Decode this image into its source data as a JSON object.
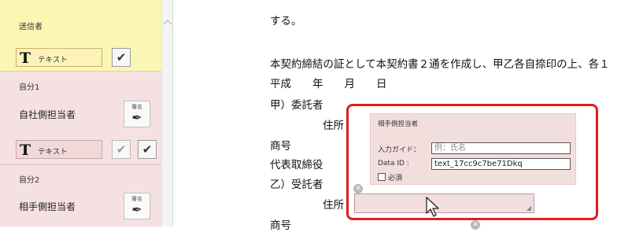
{
  "sidebar": {
    "sender": {
      "title": "送信者",
      "text_field_glyph": "T",
      "text_field_label": "テキスト"
    },
    "self1": {
      "title": "自分1",
      "role": "自社側担当者",
      "sign_label": "署名",
      "text_field_glyph": "T",
      "text_field_label": "テキスト"
    },
    "self2": {
      "title": "自分2",
      "role": "相手側担当者",
      "sign_label": "署名"
    }
  },
  "document": {
    "lines": [
      "する。",
      "本契約締結の証として本契約書２通を作成し、甲乙各自捺印の上、各１",
      "平成　　年　　月　　日",
      "甲）委託者",
      "住所",
      "商号",
      "代表取締役",
      "乙）受託者",
      "住所",
      "商号"
    ]
  },
  "field_panel": {
    "title": "相手側担当者",
    "guide_label": "入力ガイド：",
    "guide_value": "例：氏名",
    "dataid_label": "Data ID :",
    "dataid_value": "text_17cc9c7be71Dkq",
    "required_label": "必須"
  },
  "colors": {
    "sender_bg": "#fbf6b3",
    "self_bg": "#f5e1e1",
    "highlight": "#e01e1e"
  },
  "icons": {
    "check": "✔",
    "pen": "✒",
    "close": "✕"
  }
}
